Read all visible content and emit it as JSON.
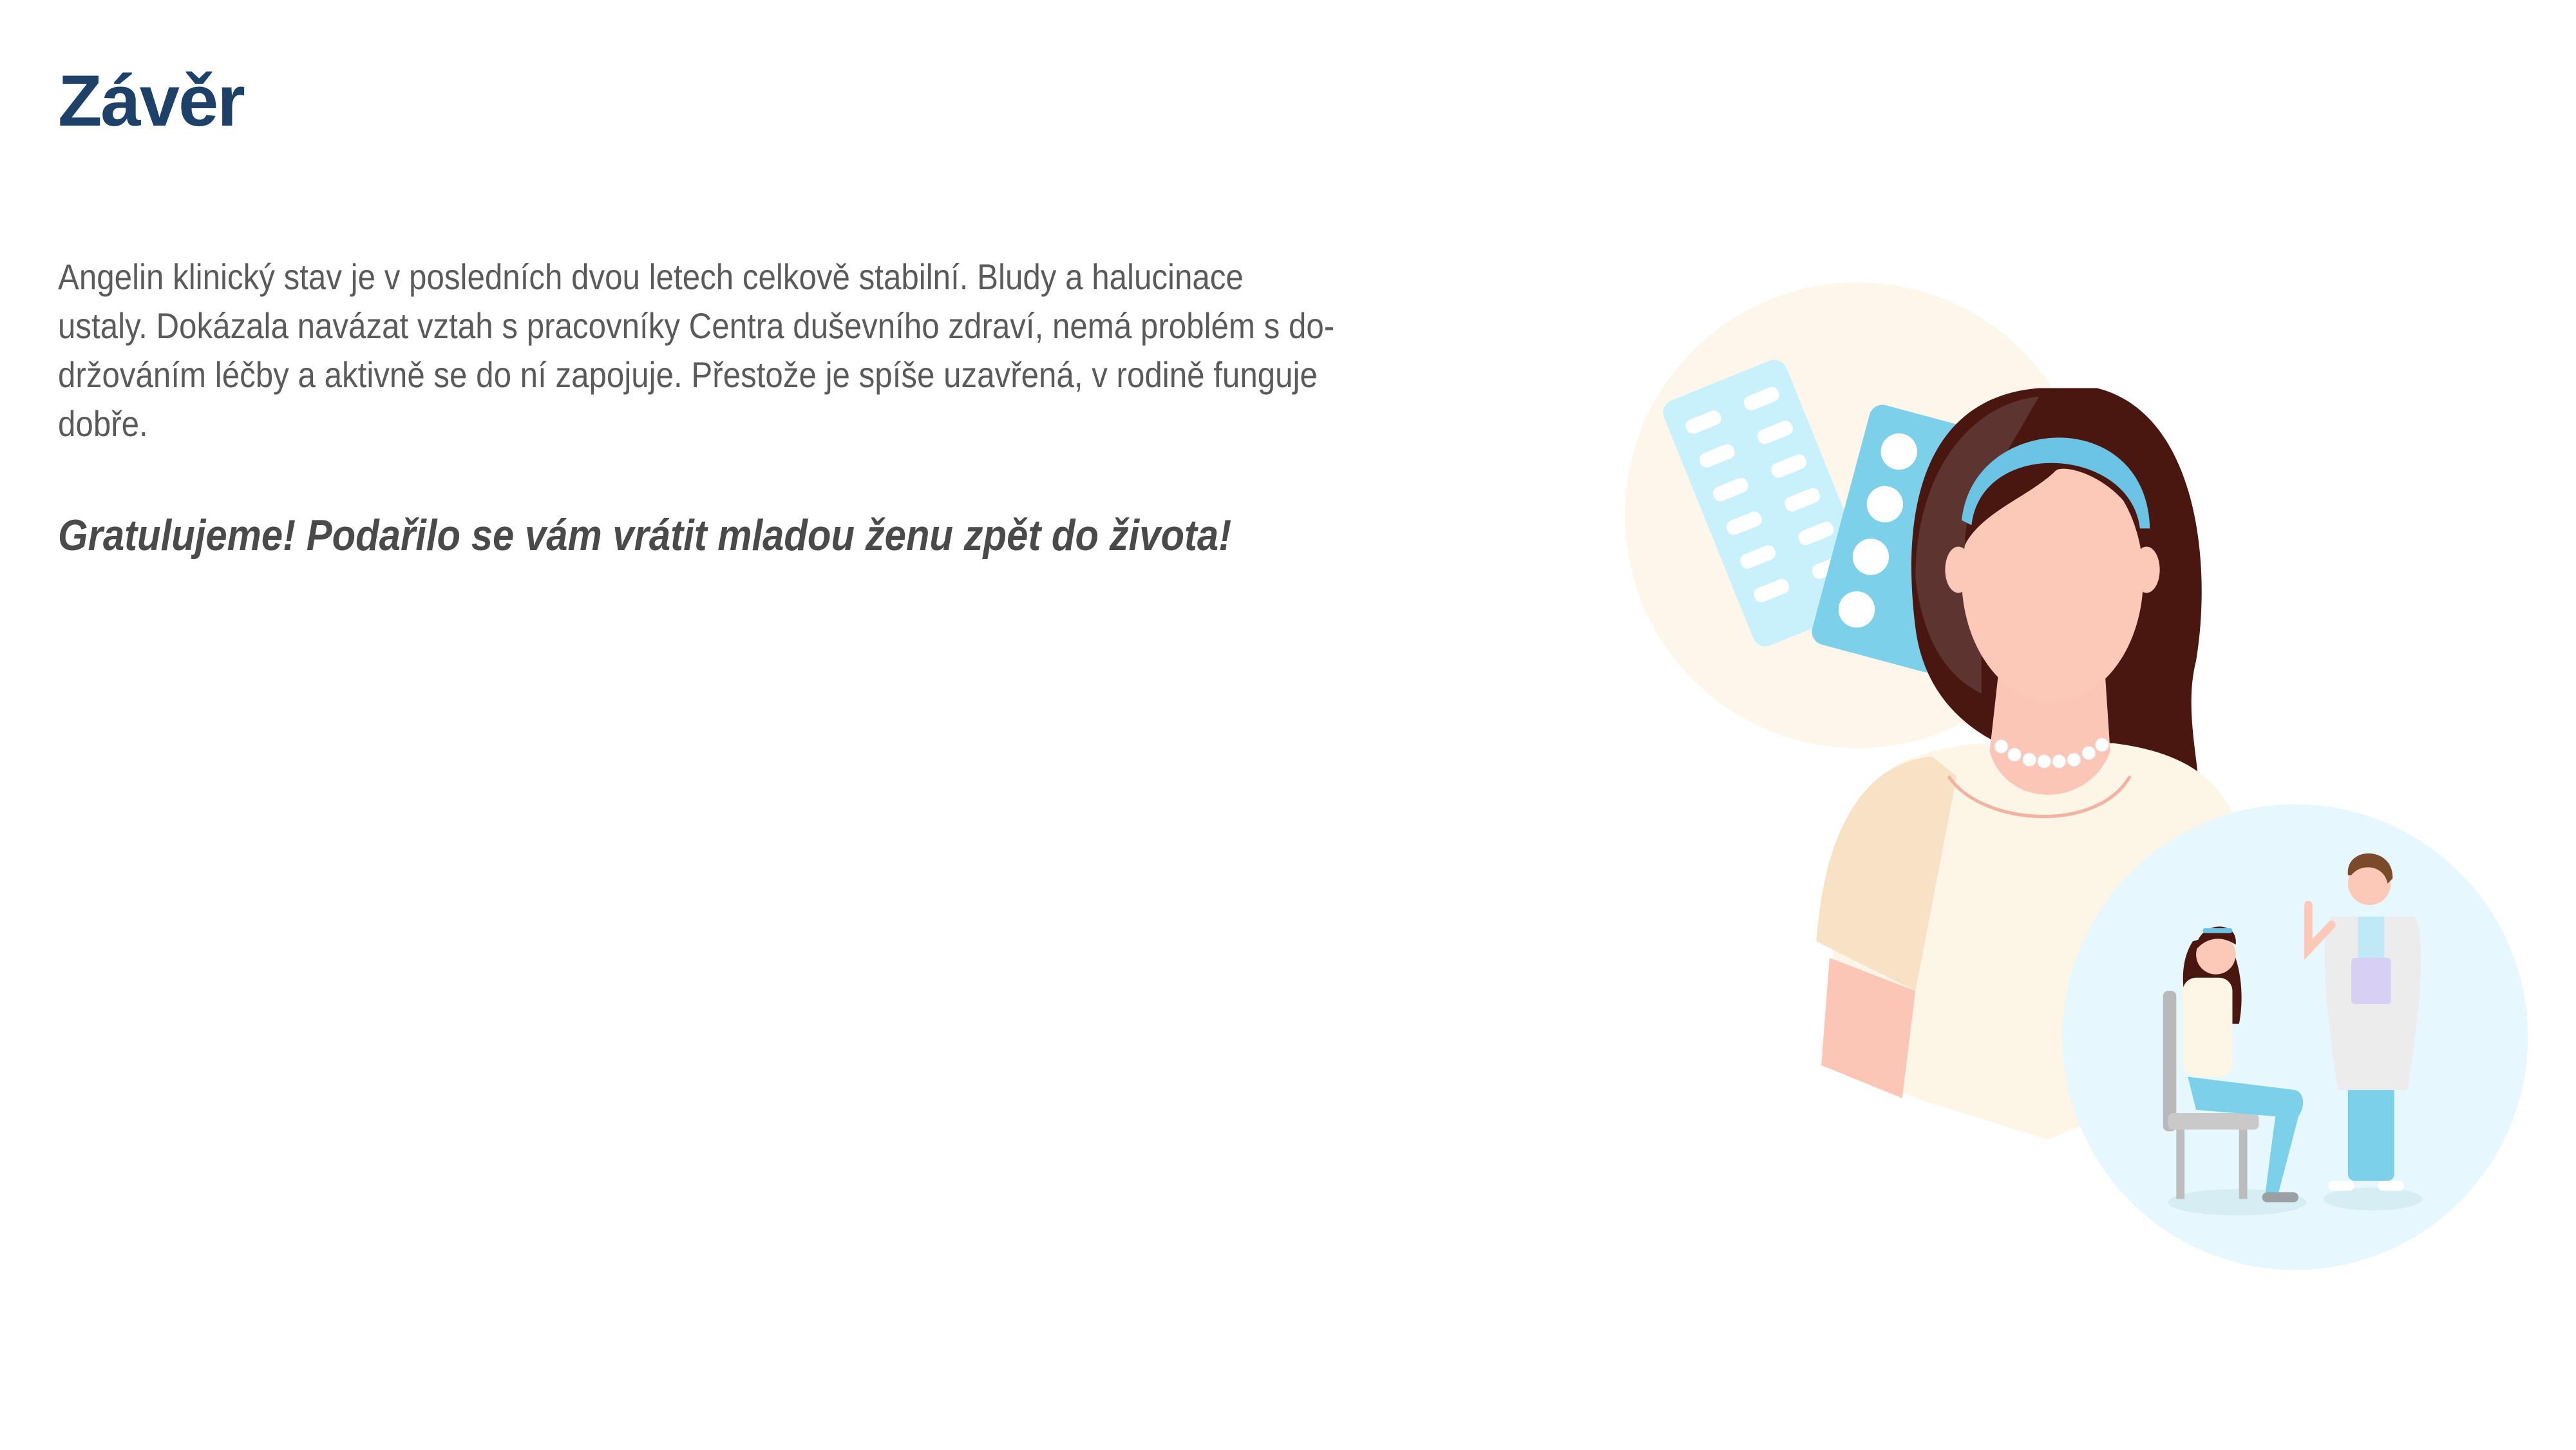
{
  "title": "Závěr",
  "paragraph_lines": [
    "Angelin klinický stav je v posledních dvou letech celkově stabilní. Bludy a halucinace",
    "ustaly. Dokázala navázat vztah s pracovníky Centra duševního zdraví, nemá problém s do-",
    "držováním léčby a aktivně se do ní zapojuje. Přestože je spíše uzavřená, v rodině funguje",
    "dobře."
  ],
  "congratulation": "Gratulujeme! Podařilo se vám vrátit mladou ženu zpět do života!",
  "colors": {
    "title": "#1d4168",
    "text": "#5a5a5a",
    "accent_blue": "#6cc4e4"
  }
}
